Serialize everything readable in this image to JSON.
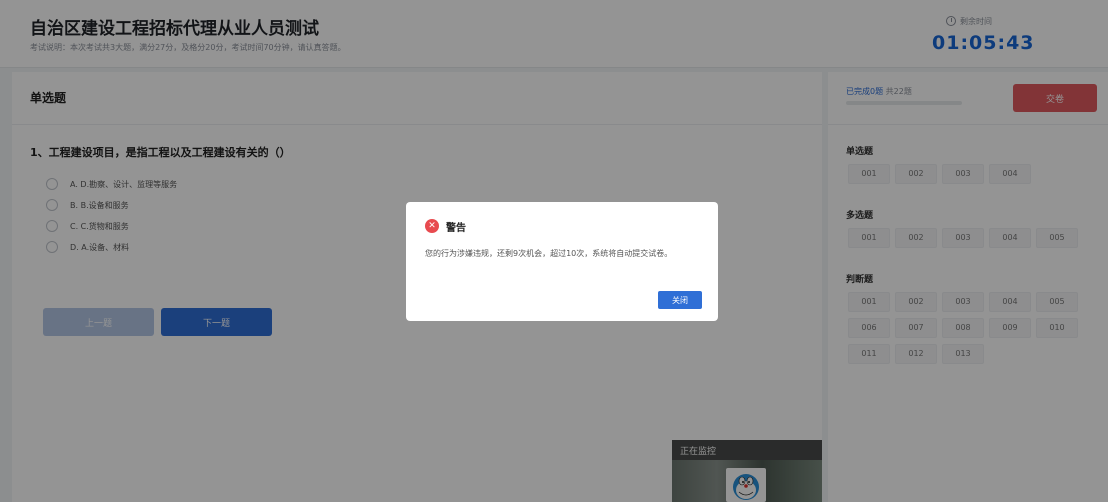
{
  "header": {
    "title": "自治区建设工程招标代理从业人员测试",
    "description": "考试说明：本次考试共3大题，满分27分，及格分20分，考试时间70分钟，请认真答题。",
    "timer_label": "剩余时间",
    "timer_value": "01:05:43"
  },
  "main": {
    "section_title": "单选题",
    "question": "1、工程建设项目，是指工程以及工程建设有关的（）",
    "options": [
      "A. D.勘察、设计、监理等服务",
      "B. B.设备和服务",
      "C. C.货物和服务",
      "D. A.设备、材料"
    ],
    "prev_label": "上一题",
    "next_label": "下一题"
  },
  "sidebar": {
    "progress_done": "已完成0题",
    "progress_total": "共22题",
    "progress_fraction": 0,
    "submit_label": "交卷",
    "groups": [
      {
        "title": "单选题",
        "items": [
          "001",
          "002",
          "003",
          "004"
        ]
      },
      {
        "title": "多选题",
        "items": [
          "001",
          "002",
          "003",
          "004",
          "005"
        ]
      },
      {
        "title": "判断题",
        "items": [
          "001",
          "002",
          "003",
          "004",
          "005",
          "006",
          "007",
          "008",
          "009",
          "010",
          "011",
          "012",
          "013"
        ]
      }
    ]
  },
  "camera": {
    "label": "正在监控"
  },
  "dialog": {
    "title": "警告",
    "message": "您的行为涉嫌违规，还剩9次机会，超过10次，系统将自动提交试卷。",
    "close_label": "关闭"
  },
  "colors": {
    "primary": "#2f6fd6",
    "danger": "#e05a5f",
    "timer": "#1766d6"
  }
}
